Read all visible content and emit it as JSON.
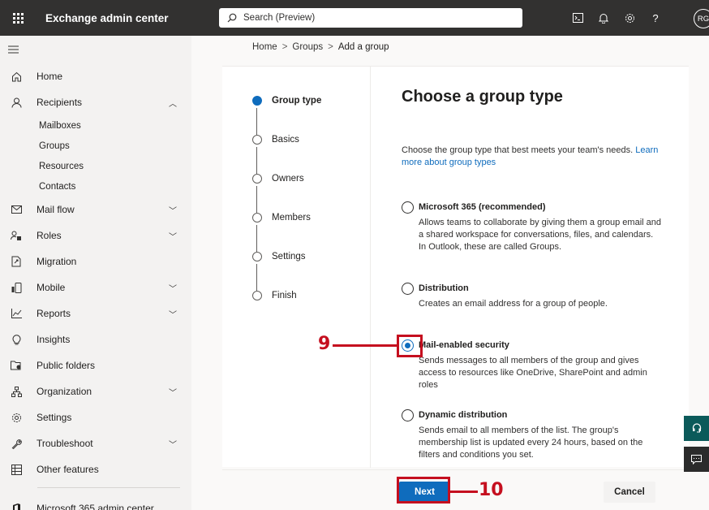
{
  "topbar": {
    "app_title": "Exchange admin center",
    "search_placeholder": "Search (Preview)",
    "avatar_initials": "RG"
  },
  "sidebar": {
    "items": [
      {
        "label": "Home",
        "icon": "home-icon",
        "chevron": ""
      },
      {
        "label": "Recipients",
        "icon": "person-icon",
        "chevron": "up"
      },
      {
        "label": "Mail flow",
        "icon": "mail-icon",
        "chevron": "down"
      },
      {
        "label": "Roles",
        "icon": "roles-icon",
        "chevron": "down"
      },
      {
        "label": "Migration",
        "icon": "migration-icon",
        "chevron": ""
      },
      {
        "label": "Mobile",
        "icon": "mobile-icon",
        "chevron": "down"
      },
      {
        "label": "Reports",
        "icon": "chart-icon",
        "chevron": "down"
      },
      {
        "label": "Insights",
        "icon": "lightbulb-icon",
        "chevron": ""
      },
      {
        "label": "Public folders",
        "icon": "folder-icon",
        "chevron": ""
      },
      {
        "label": "Organization",
        "icon": "org-icon",
        "chevron": "down"
      },
      {
        "label": "Settings",
        "icon": "gear-icon",
        "chevron": ""
      },
      {
        "label": "Troubleshoot",
        "icon": "wrench-icon",
        "chevron": "down"
      },
      {
        "label": "Other features",
        "icon": "grid-icon",
        "chevron": ""
      }
    ],
    "recipients_sub": [
      "Mailboxes",
      "Groups",
      "Resources",
      "Contacts"
    ],
    "m365_label": "Microsoft 365 admin center"
  },
  "breadcrumb": {
    "home": "Home",
    "groups": "Groups",
    "current": "Add a group"
  },
  "wizard": {
    "steps": [
      {
        "label": "Group type",
        "active": true
      },
      {
        "label": "Basics",
        "active": false
      },
      {
        "label": "Owners",
        "active": false
      },
      {
        "label": "Members",
        "active": false
      },
      {
        "label": "Settings",
        "active": false
      },
      {
        "label": "Finish",
        "active": false
      }
    ],
    "heading": "Choose a group type",
    "description": "Choose the group type that best meets your team's needs.",
    "link_text": "Learn more about group types",
    "options": [
      {
        "title": "Microsoft 365 (recommended)",
        "desc": "Allows teams to collaborate by giving them a group email and a shared workspace for conversations, files, and calendars. In Outlook, these are called Groups.",
        "checked": false
      },
      {
        "title": "Distribution",
        "desc": "Creates an email address for a group of people.",
        "checked": false
      },
      {
        "title": "Mail-enabled security",
        "desc": "Sends messages to all members of the group and gives access to resources like OneDrive, SharePoint and admin roles",
        "checked": true
      },
      {
        "title": "Dynamic distribution",
        "desc": "Sends email to all members of the list. The group's membership list is updated every 24 hours, based on the filters and conditions you set.",
        "checked": false
      }
    ],
    "next_label": "Next",
    "cancel_label": "Cancel"
  },
  "annotations": {
    "step9": "9",
    "step10": "10",
    "color": "#c50f1f"
  },
  "colors": {
    "accent": "#0f6cbd",
    "topbar": "#323130",
    "sidebar": "#f3f2f1"
  }
}
